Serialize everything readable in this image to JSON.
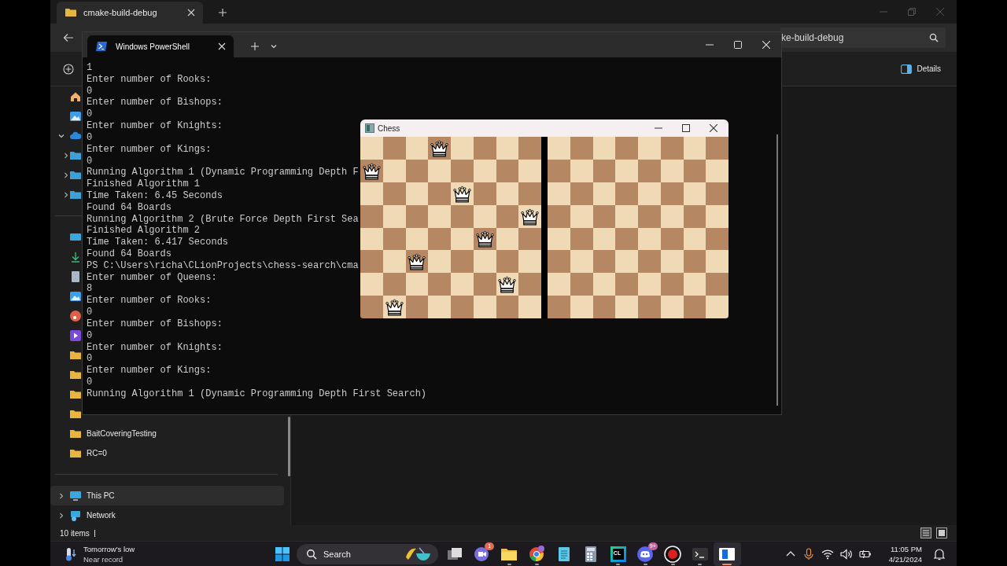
{
  "explorer": {
    "tab": {
      "title": "cmake-build-debug",
      "selected": true
    },
    "search": {
      "placeholder": "ke-build-debug"
    },
    "details_button": "Details",
    "sidebar": {
      "items": [
        {
          "kind": "folder",
          "label": "BaitCoveringTesting",
          "selected": false
        },
        {
          "kind": "folder",
          "label": "RC=0",
          "selected": false
        },
        {
          "kind": "pc",
          "label": "This PC",
          "selected": true
        },
        {
          "kind": "network",
          "label": "Network",
          "selected": false
        }
      ]
    },
    "status_bar": {
      "count": "10 items"
    }
  },
  "terminal": {
    "tab": {
      "title": "Windows PowerShell",
      "selected": true
    },
    "lines": [
      "1",
      "Enter number of Rooks:",
      "0",
      "Enter number of Bishops:",
      "0",
      "Enter number of Knights:",
      "0",
      "Enter number of Kings:",
      "0",
      "Running Algorithm 1 (Dynamic Programming Depth F",
      "Finished Algorithm 1",
      "Time Taken: 6.45 Seconds",
      "Found 64 Boards",
      "Running Algorithm 2 (Brute Force Depth First Sea",
      "Finished Algorithm 2",
      "Time Taken: 6.417 Seconds",
      "Found 64 Boards",
      "PS C:\\Users\\richa\\CLionProjects\\chess-search\\cma",
      "Enter number of Queens:",
      "8",
      "Enter number of Rooks:",
      "0",
      "Enter number of Bishops:",
      "0",
      "Enter number of Knights:",
      "0",
      "Enter number of Kings:",
      "0",
      "Running Algorithm 1 (Dynamic Programming Depth First Search)"
    ]
  },
  "chess": {
    "title": "Chess",
    "boards": [
      {
        "ranks": [
          {
            "squares": [
              {
                "queen": false
              },
              {
                "queen": false
              },
              {
                "queen": false
              },
              {
                "queen": true
              },
              {
                "queen": false
              },
              {
                "queen": false
              },
              {
                "queen": false
              },
              {
                "queen": false
              }
            ]
          },
          {
            "squares": [
              {
                "queen": true
              },
              {
                "queen": false
              },
              {
                "queen": false
              },
              {
                "queen": false
              },
              {
                "queen": false
              },
              {
                "queen": false
              },
              {
                "queen": false
              },
              {
                "queen": false
              }
            ]
          },
          {
            "squares": [
              {
                "queen": false
              },
              {
                "queen": false
              },
              {
                "queen": false
              },
              {
                "queen": false
              },
              {
                "queen": true
              },
              {
                "queen": false
              },
              {
                "queen": false
              },
              {
                "queen": false
              }
            ]
          },
          {
            "squares": [
              {
                "queen": false
              },
              {
                "queen": false
              },
              {
                "queen": false
              },
              {
                "queen": false
              },
              {
                "queen": false
              },
              {
                "queen": false
              },
              {
                "queen": false
              },
              {
                "queen": true
              }
            ]
          },
          {
            "squares": [
              {
                "queen": false
              },
              {
                "queen": false
              },
              {
                "queen": false
              },
              {
                "queen": false
              },
              {
                "queen": false
              },
              {
                "queen": true
              },
              {
                "queen": false
              },
              {
                "queen": false
              }
            ]
          },
          {
            "squares": [
              {
                "queen": false
              },
              {
                "queen": false
              },
              {
                "queen": true
              },
              {
                "queen": false
              },
              {
                "queen": false
              },
              {
                "queen": false
              },
              {
                "queen": false
              },
              {
                "queen": false
              }
            ]
          },
          {
            "squares": [
              {
                "queen": false
              },
              {
                "queen": false
              },
              {
                "queen": false
              },
              {
                "queen": false
              },
              {
                "queen": false
              },
              {
                "queen": false
              },
              {
                "queen": true
              },
              {
                "queen": false
              }
            ]
          },
          {
            "squares": [
              {
                "queen": false
              },
              {
                "queen": true
              },
              {
                "queen": false
              },
              {
                "queen": false
              },
              {
                "queen": false
              },
              {
                "queen": false
              },
              {
                "queen": false
              },
              {
                "queen": false
              }
            ]
          }
        ]
      },
      {
        "ranks": [
          {
            "squares": [
              {
                "queen": false
              },
              {
                "queen": false
              },
              {
                "queen": false
              },
              {
                "queen": false
              },
              {
                "queen": false
              },
              {
                "queen": false
              },
              {
                "queen": false
              },
              {
                "queen": false
              }
            ]
          },
          {
            "squares": [
              {
                "queen": false
              },
              {
                "queen": false
              },
              {
                "queen": false
              },
              {
                "queen": false
              },
              {
                "queen": false
              },
              {
                "queen": false
              },
              {
                "queen": false
              },
              {
                "queen": false
              }
            ]
          },
          {
            "squares": [
              {
                "queen": false
              },
              {
                "queen": false
              },
              {
                "queen": false
              },
              {
                "queen": false
              },
              {
                "queen": false
              },
              {
                "queen": false
              },
              {
                "queen": false
              },
              {
                "queen": false
              }
            ]
          },
          {
            "squares": [
              {
                "queen": false
              },
              {
                "queen": false
              },
              {
                "queen": false
              },
              {
                "queen": false
              },
              {
                "queen": false
              },
              {
                "queen": false
              },
              {
                "queen": false
              },
              {
                "queen": false
              }
            ]
          },
          {
            "squares": [
              {
                "queen": false
              },
              {
                "queen": false
              },
              {
                "queen": false
              },
              {
                "queen": false
              },
              {
                "queen": false
              },
              {
                "queen": false
              },
              {
                "queen": false
              },
              {
                "queen": false
              }
            ]
          },
          {
            "squares": [
              {
                "queen": false
              },
              {
                "queen": false
              },
              {
                "queen": false
              },
              {
                "queen": false
              },
              {
                "queen": false
              },
              {
                "queen": false
              },
              {
                "queen": false
              },
              {
                "queen": false
              }
            ]
          },
          {
            "squares": [
              {
                "queen": false
              },
              {
                "queen": false
              },
              {
                "queen": false
              },
              {
                "queen": false
              },
              {
                "queen": false
              },
              {
                "queen": false
              },
              {
                "queen": false
              },
              {
                "queen": false
              }
            ]
          },
          {
            "squares": [
              {
                "queen": false
              },
              {
                "queen": false
              },
              {
                "queen": false
              },
              {
                "queen": false
              },
              {
                "queen": false
              },
              {
                "queen": false
              },
              {
                "queen": false
              },
              {
                "queen": false
              }
            ]
          }
        ]
      }
    ]
  },
  "taskbar": {
    "weather": {
      "title": "Tomorrow's low",
      "subtitle": "Near record"
    },
    "search": {
      "label": "Search"
    },
    "apps": [
      {
        "kind": "task-view",
        "running": false,
        "active": false
      },
      {
        "kind": "meet",
        "badge": "1",
        "running": false,
        "active": false
      },
      {
        "kind": "explorer",
        "running": true,
        "active": false
      },
      {
        "kind": "chrome",
        "running": true,
        "active": false
      },
      {
        "kind": "notepad",
        "running": false,
        "active": false
      },
      {
        "kind": "calculator",
        "running": false,
        "active": false
      },
      {
        "kind": "clion",
        "label": "CL",
        "running": true,
        "active": false
      },
      {
        "kind": "discord",
        "badge": "9+",
        "running": true,
        "active": false
      },
      {
        "kind": "recorder",
        "running": true,
        "active": false
      },
      {
        "kind": "terminal",
        "running": true,
        "active": false
      },
      {
        "kind": "app",
        "running": true,
        "active": true
      }
    ],
    "clock": {
      "time": "11:05 PM",
      "date": "4/21/2024"
    }
  }
}
